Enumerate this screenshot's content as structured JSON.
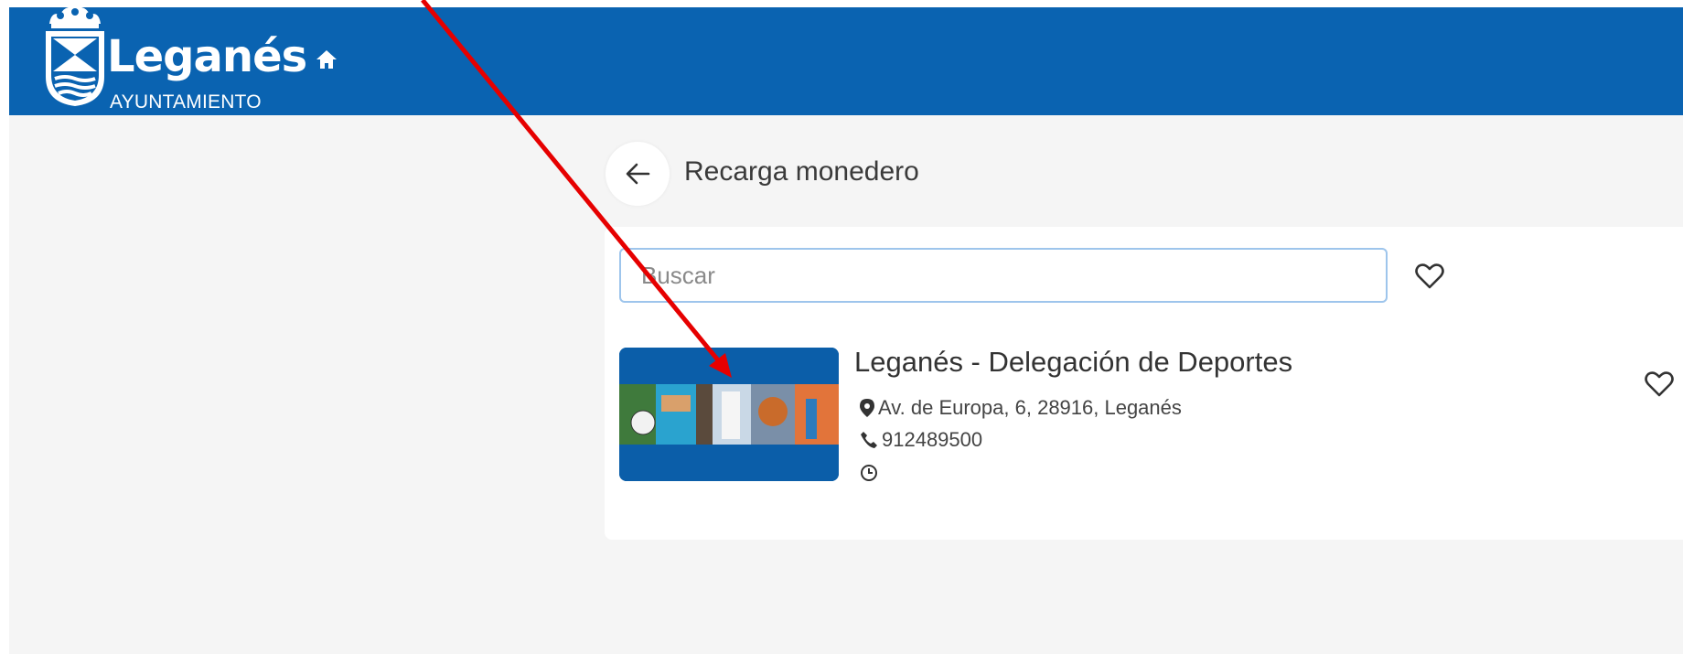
{
  "header": {
    "brand_name": "Leganés",
    "brand_subtitle": "AYUNTAMIENTO",
    "logo_icon": "leganes-coat-of-arms",
    "home_icon": "home-icon",
    "bar_color": "#0a63b1"
  },
  "page": {
    "title": "Recarga monedero",
    "back_icon": "arrow-left-icon"
  },
  "search": {
    "placeholder": "Buscar",
    "value": "",
    "favorite_filter_icon": "heart-outline-icon"
  },
  "results": [
    {
      "title": "Leganés - Delegación de Deportes",
      "address": "Av. de Europa, 6, 28916, Leganés",
      "phone": "912489500",
      "hours": "",
      "favorite_icon": "heart-outline-icon"
    }
  ],
  "annotation": {
    "type": "red-arrow",
    "color": "#e60000"
  }
}
